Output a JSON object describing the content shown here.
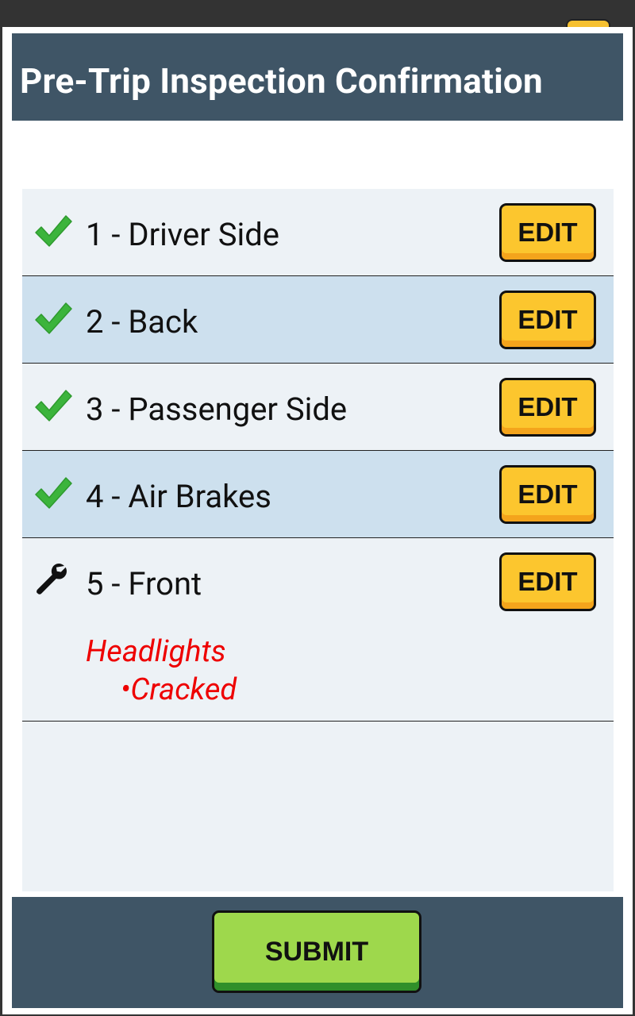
{
  "dialog": {
    "title": "Pre-Trip Inspection Confirmation"
  },
  "sections": [
    {
      "label": "1 - Driver Side",
      "status_icon": "check-icon",
      "edit_label": "EDIT"
    },
    {
      "label": "2 - Back",
      "status_icon": "check-icon",
      "edit_label": "EDIT"
    },
    {
      "label": "3 - Passenger Side",
      "status_icon": "check-icon",
      "edit_label": "EDIT"
    },
    {
      "label": "4 - Air Brakes",
      "status_icon": "check-icon",
      "edit_label": "EDIT"
    },
    {
      "label": "5 - Front",
      "status_icon": "wrench-icon",
      "edit_label": "EDIT",
      "issues": [
        {
          "category": "Headlights",
          "detail": "•Cracked"
        }
      ]
    }
  ],
  "footer": {
    "submit_label": "SUBMIT"
  },
  "colors": {
    "header_bg": "#3f5566",
    "list_bg": "#edf2f6",
    "alt_row_bg": "#cde0ee",
    "edit_button": "#fcc62e",
    "submit_button": "#9ed84c",
    "issue_text": "#ee0000",
    "check_green": "#3cb43c"
  }
}
